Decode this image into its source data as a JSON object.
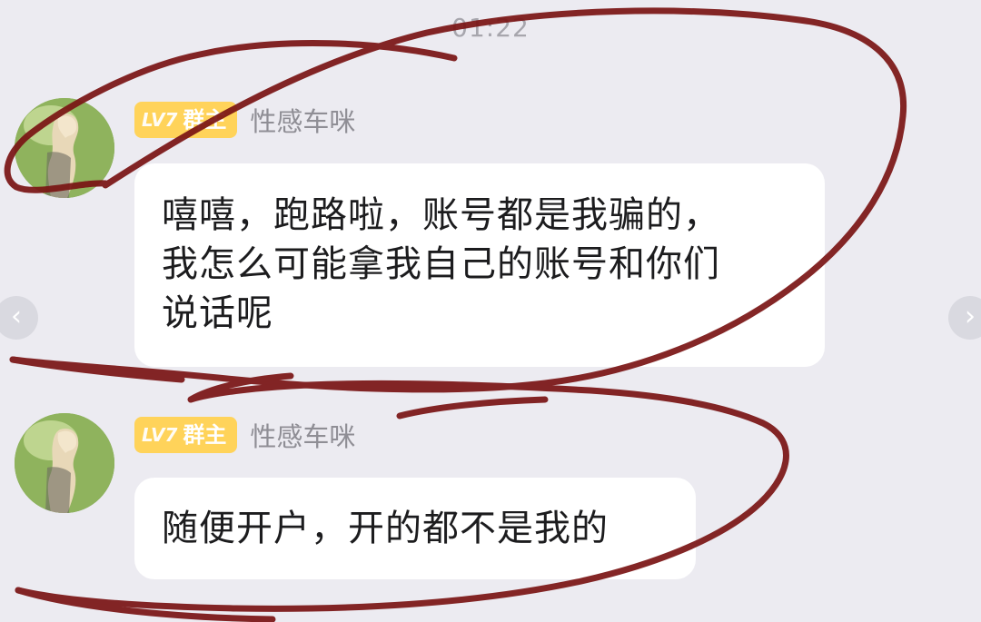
{
  "timestamp": "01:22",
  "messages": [
    {
      "level_badge": "LV7",
      "role_badge": "群主",
      "nickname": "性感车咪",
      "text_lines": [
        "嘻嘻，跑路啦，账号都是我骗的，",
        "我怎么可能拿我自己的账号和你们",
        "说话呢"
      ]
    },
    {
      "level_badge": "LV7",
      "role_badge": "群主",
      "nickname": "性感车咪",
      "text_lines": [
        "随便开户，开的都不是我的"
      ]
    }
  ],
  "nav": {
    "prev": "‹",
    "next": "›"
  },
  "colors": {
    "background": "#ecebf1",
    "bubble": "#ffffff",
    "badge": "#ffd35a",
    "annotation_ink": "#7a1414"
  },
  "icons": {
    "avatar": "avatar-photo",
    "prev": "chevron-left-icon",
    "next": "chevron-right-icon"
  }
}
